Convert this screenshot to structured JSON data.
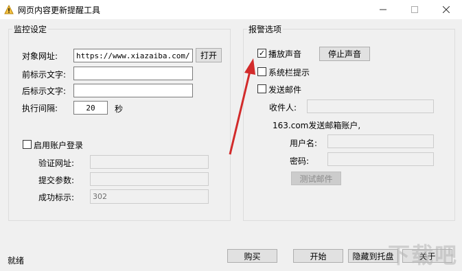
{
  "window": {
    "title": "网页内容更新提醒工具"
  },
  "monitor": {
    "legend": "监控设定",
    "url_label": "对象网址:",
    "url_value": "https://www.xiazaiba.com/",
    "open_button": "打开",
    "prefix_label": "前标示文字:",
    "prefix_value": "",
    "suffix_label": "后标示文字:",
    "suffix_value": "",
    "interval_label": "执行间隔:",
    "interval_value": "20",
    "interval_unit": "秒",
    "account_login_label": "启用账户登录",
    "verify_url_label": "验证网址:",
    "verify_url_value": "",
    "submit_params_label": "提交参数:",
    "submit_params_value": "",
    "success_label": "成功标示:",
    "success_value": "302"
  },
  "alarm": {
    "legend": "报警选项",
    "play_sound_label": "播放声音",
    "play_sound_checked": true,
    "stop_sound_button": "停止声音",
    "tray_tip_label": "系统栏提示",
    "send_mail_label": "发送邮件",
    "recipient_label": "收件人:",
    "recipient_value": "",
    "sender_label": "163.com发送邮箱账户,",
    "username_label": "用户名:",
    "username_value": "",
    "password_label": "密码:",
    "password_value": "",
    "test_mail_button": "测试邮件"
  },
  "footer": {
    "status": "就绪",
    "buy_button": "购买",
    "start_button": "开始",
    "hide_tray_button": "隐藏到托盘",
    "about_button": "关于"
  },
  "watermark": "下载吧",
  "colors": {
    "arrow": "#d22b2b",
    "window_bg": "#f0f0f0"
  }
}
